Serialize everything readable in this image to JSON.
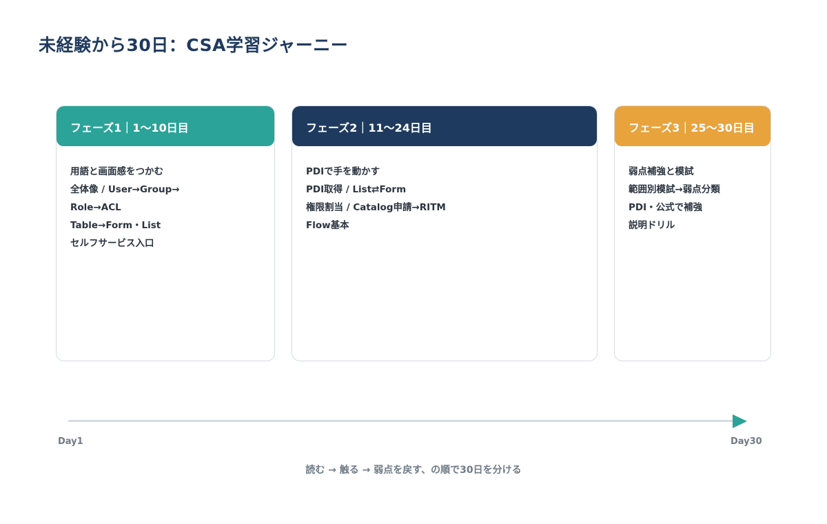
{
  "title": "未経験から30日：CSA学習ジャーニー",
  "colors": {
    "phase1": "#2ba399",
    "phase2": "#1f3a5f",
    "phase3": "#e8a33c",
    "timeline": "#d5dce1",
    "arrow": "#2ba399"
  },
  "phases": [
    {
      "header": "フェーズ1｜1〜10日目",
      "items": [
        "用語と画面感をつかむ",
        "全体像 / User→Group→",
        "Role→ACL",
        "Table→Form・List",
        "セルフサービス入口"
      ]
    },
    {
      "header": "フェーズ2｜11〜24日目",
      "items": [
        "PDIで手を動かす",
        "PDI取得 / List⇄Form",
        "権限割当 / Catalog申請→RITM",
        "Flow基本"
      ]
    },
    {
      "header": "フェーズ3｜25〜30日目",
      "items": [
        "弱点補強と模試",
        "範囲別模試→弱点分類",
        "PDI・公式で補強",
        "説明ドリル"
      ]
    }
  ],
  "timeline": {
    "start_label": "Day1",
    "end_label": "Day30"
  },
  "caption": "読む → 触る → 弱点を戻す、の順で30日を分ける"
}
